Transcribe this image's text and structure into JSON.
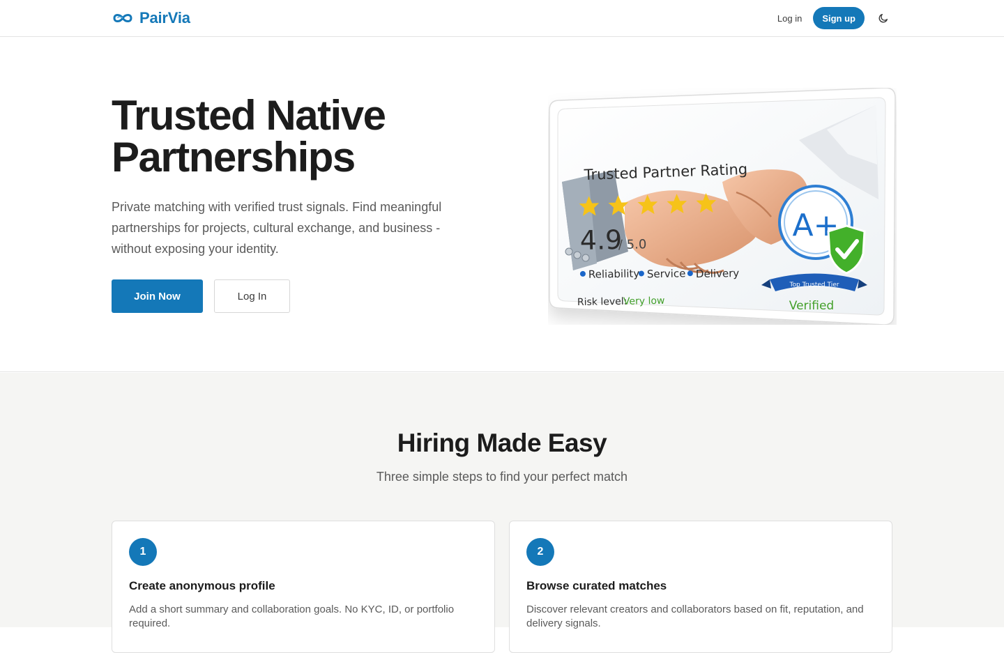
{
  "header": {
    "brand_name": "PairVia",
    "login_label": "Log in",
    "signup_label": "Sign up"
  },
  "hero": {
    "title": "Trusted Native Partnerships",
    "subtitle": "Private matching with verified trust signals. Find meaningful partnerships for projects, cultural exchange, and business - without exposing your identity.",
    "join_label": "Join Now",
    "login_label": "Log In",
    "card": {
      "heading": "Trusted Partner Rating",
      "score": "4.9",
      "score_max": "/ 5.0",
      "stars": 5,
      "signals": [
        "Reliability",
        "Service",
        "Delivery"
      ],
      "risk_label": "Risk level:",
      "risk_value": "Very low",
      "grade": "A+",
      "tier_label": "Top Trusted Tier",
      "verified_label": "Verified"
    }
  },
  "steps": {
    "title": "Hiring Made Easy",
    "subtitle": "Three simple steps to find your perfect match",
    "items": [
      {
        "number": "1",
        "title": "Create anonymous profile",
        "description": "Add a short summary and collaboration goals. No KYC, ID, or portfolio required."
      },
      {
        "number": "2",
        "title": "Browse curated matches",
        "description": "Discover relevant creators and collaborators based on fit, reputation, and delivery signals."
      }
    ]
  },
  "colors": {
    "accent": "#1478b8",
    "star": "#f6c319",
    "verified_green": "#43b02a"
  }
}
